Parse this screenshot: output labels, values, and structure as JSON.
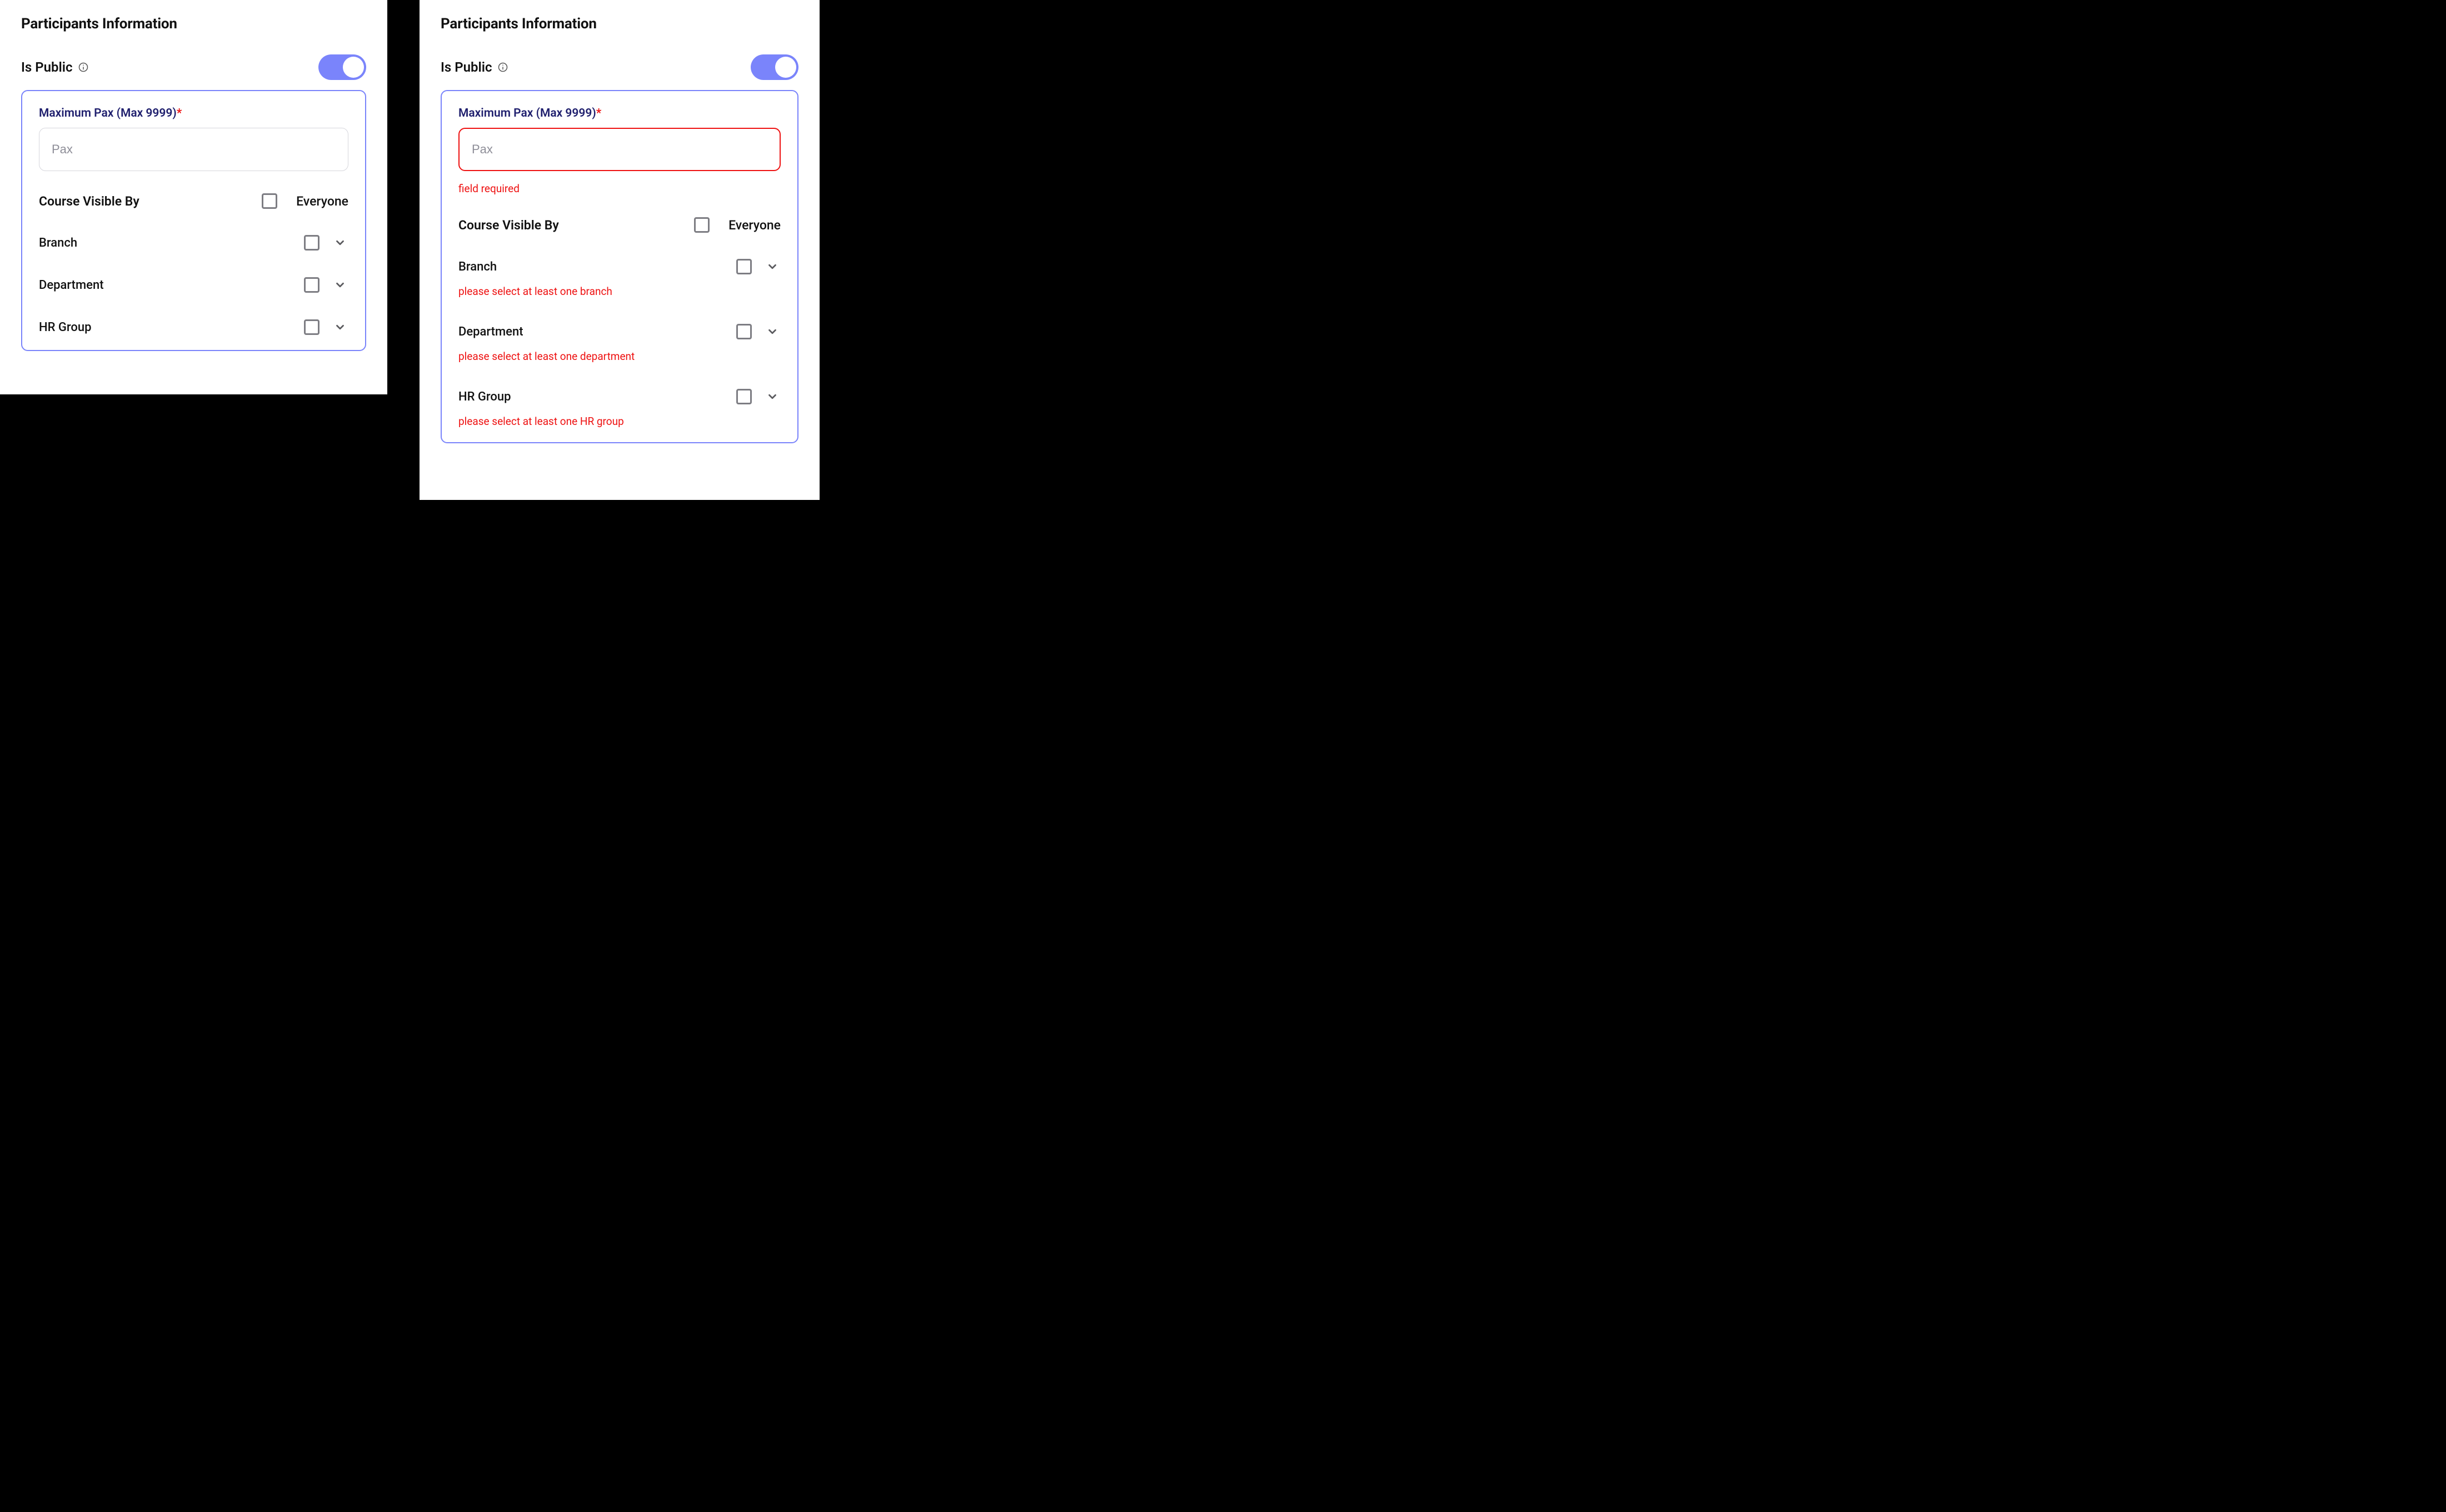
{
  "left": {
    "title": "Participants Information",
    "public_label": "Is Public",
    "box": {
      "max_pax_label": "Maximum Pax (Max 9999)",
      "required_star": "*",
      "pax_placeholder": "Pax",
      "visible_by_label": "Course Visible By",
      "everyone_label": "Everyone",
      "filters": {
        "branch": "Branch",
        "department": "Department",
        "hr_group": "HR Group"
      }
    }
  },
  "right": {
    "title": "Participants Information",
    "public_label": "Is Public",
    "box": {
      "max_pax_label": "Maximum Pax (Max 9999)",
      "required_star": "*",
      "pax_placeholder": "Pax",
      "pax_error": "field required",
      "visible_by_label": "Course Visible By",
      "everyone_label": "Everyone",
      "filters": {
        "branch": "Branch",
        "branch_error": "please select at least one branch",
        "department": "Department",
        "department_error": "please select at least one department",
        "hr_group": "HR Group",
        "hr_group_error": "please select at least one HR group"
      }
    }
  }
}
